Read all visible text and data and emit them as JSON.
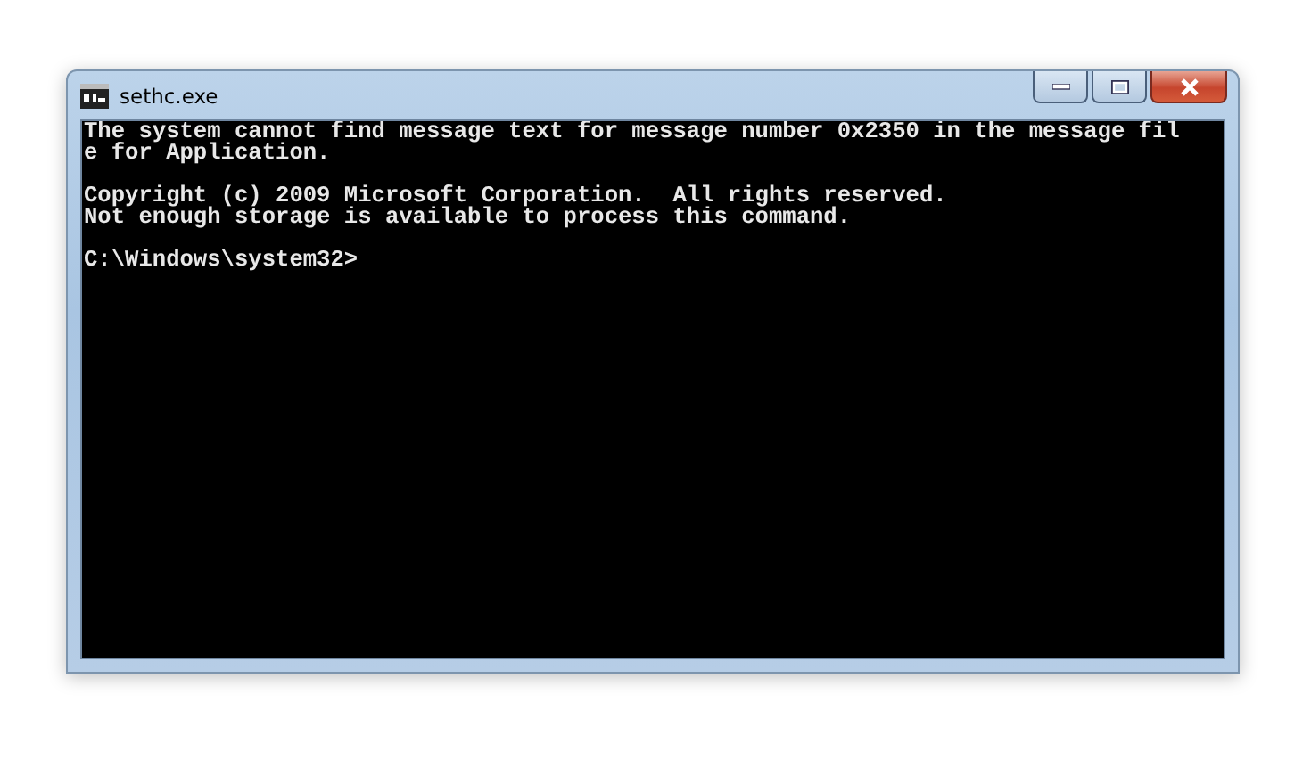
{
  "window": {
    "title": "sethc.exe"
  },
  "console": {
    "blocks": [
      [
        "The system cannot find message text for message number 0x2350 in the message fil",
        "e for Application."
      ],
      [
        "Copyright (c) 2009 Microsoft Corporation.  All rights reserved.",
        "Not enough storage is available to process this command."
      ],
      [
        "C:\\Windows\\system32>"
      ]
    ]
  }
}
